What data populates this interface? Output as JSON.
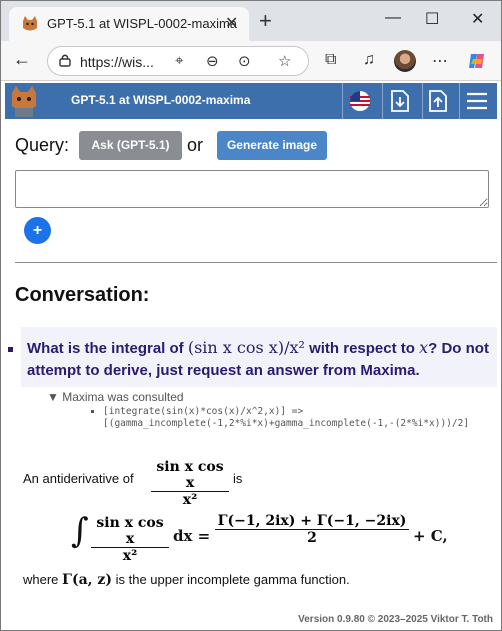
{
  "browser": {
    "tab_title": "GPT-5.1 at WISPL-0002-maxima",
    "url": "https://wis..."
  },
  "app": {
    "title": "GPT-5.1 at WISPL-0002-maxima",
    "accent": "#3e6fad"
  },
  "query": {
    "label": "Query:",
    "ask_button": "Ask (GPT-5.1)",
    "or": "or",
    "generate_button": "Generate image",
    "input_value": "",
    "add_button": "+"
  },
  "conversation": {
    "heading": "Conversation:",
    "question_prefix": "What is the integral of ",
    "question_math": "(sin x cos x)/x²",
    "question_mid": " with respect to ",
    "question_var": "x",
    "question_suffix": "? Do not attempt to derive, just request an answer from Maxima.",
    "maxima_label": "Maxima was consulted",
    "maxima_code": "[integrate(sin(x)*cos(x)/x^2,x)] => [(gamma_incomplete(-1,2*%i*x)+gamma_incomplete(-1,-(2*%i*x)))/2]",
    "answer_prefix": "An antiderivative of",
    "answer_num": "sin x cos x",
    "answer_den": "x²",
    "answer_is": "is",
    "eq_integral": "∫",
    "eq_lhs_num": "sin x cos x",
    "eq_lhs_den": "x²",
    "eq_dx": "dx =",
    "eq_rhs_num": "Γ(−1, 2ix) + Γ(−1, −2ix)",
    "eq_rhs_den": "2",
    "eq_tail": "+ C,",
    "where_prefix": "where ",
    "where_math": "Γ(a, z)",
    "where_suffix": " is the upper incomplete gamma function."
  },
  "footer": {
    "version": "Version 0.9.80 © 2023–2025 Viktor T. Toth"
  }
}
